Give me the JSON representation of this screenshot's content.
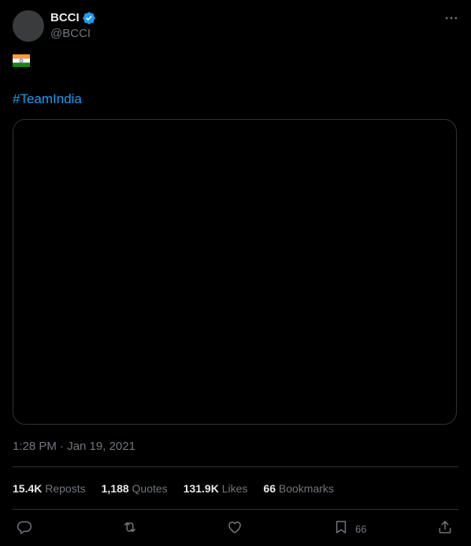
{
  "author": {
    "display_name": "BCCI",
    "handle": "@BCCI",
    "verified_icon": "verified-badge-icon"
  },
  "content": {
    "flag_emoji": "india-flag",
    "hashtag": "#TeamIndia"
  },
  "meta": {
    "timestamp": "1:28 PM · Jan 19, 2021"
  },
  "stats": [
    {
      "value": "15.4K",
      "label": "Reposts"
    },
    {
      "value": "1,188",
      "label": "Quotes"
    },
    {
      "value": "131.9K",
      "label": "Likes"
    },
    {
      "value": "66",
      "label": "Bookmarks"
    }
  ],
  "actions": {
    "reply_icon": "reply-icon",
    "repost_icon": "repost-icon",
    "like_icon": "heart-icon",
    "bookmark_icon": "bookmark-icon",
    "bookmark_count": "66",
    "share_icon": "share-icon"
  },
  "colors": {
    "background": "#000000",
    "text_primary": "#e7e9ea",
    "text_secondary": "#71767b",
    "accent": "#1d9bf0",
    "border": "#2f3336"
  }
}
